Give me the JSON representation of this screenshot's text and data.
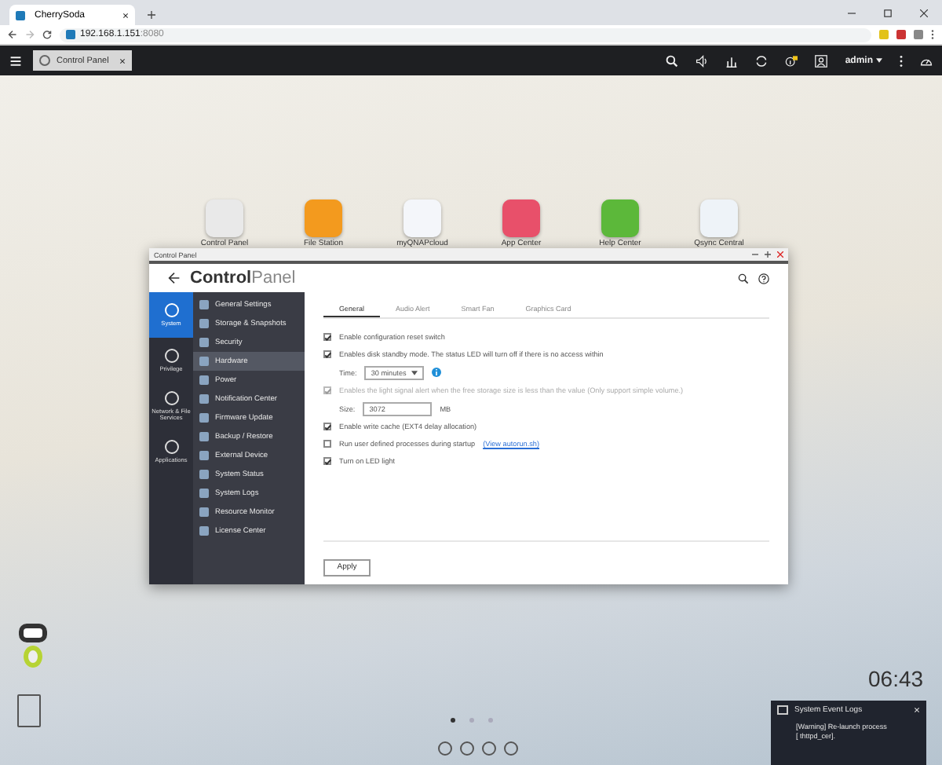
{
  "browser": {
    "tab_title": "CherrySoda",
    "url_host": "192.168.1.151",
    "url_port": ":8080"
  },
  "topbar": {
    "task": "Control Panel",
    "user": "admin"
  },
  "desktop_icons": [
    {
      "label": "Control Panel",
      "kind": "gear"
    },
    {
      "label": "File Station",
      "kind": "folder"
    },
    {
      "label": "myQNAPcloud",
      "kind": "cloud"
    },
    {
      "label": "App Center",
      "kind": "grid"
    },
    {
      "label": "Help Center",
      "kind": "help"
    },
    {
      "label": "Qsync Central",
      "kind": "sync"
    }
  ],
  "window": {
    "title": "Control Panel",
    "heading_bold": "Control",
    "heading_light": "Panel",
    "categories": [
      {
        "label": "System",
        "selected": true
      },
      {
        "label": "Privilege",
        "selected": false
      },
      {
        "label": "Network & File Services",
        "selected": false
      },
      {
        "label": "Applications",
        "selected": false
      }
    ],
    "menu": [
      {
        "label": "General Settings",
        "selected": false
      },
      {
        "label": "Storage & Snapshots",
        "selected": false
      },
      {
        "label": "Security",
        "selected": false
      },
      {
        "label": "Hardware",
        "selected": true
      },
      {
        "label": "Power",
        "selected": false
      },
      {
        "label": "Notification Center",
        "selected": false
      },
      {
        "label": "Firmware Update",
        "selected": false
      },
      {
        "label": "Backup / Restore",
        "selected": false
      },
      {
        "label": "External Device",
        "selected": false
      },
      {
        "label": "System Status",
        "selected": false
      },
      {
        "label": "System Logs",
        "selected": false
      },
      {
        "label": "Resource Monitor",
        "selected": false
      },
      {
        "label": "License Center",
        "selected": false
      }
    ],
    "tabs": [
      {
        "label": "General",
        "selected": true
      },
      {
        "label": "Audio Alert",
        "selected": false
      },
      {
        "label": "Smart Fan",
        "selected": false
      },
      {
        "label": "Graphics Card",
        "selected": false
      }
    ],
    "options": [
      {
        "kind": "checkbox",
        "label": "Enable configuration reset switch",
        "checked": true,
        "disabled": false
      },
      {
        "kind": "checkbox",
        "label": "Enables disk standby mode. The status LED will turn off if there is no access within",
        "checked": true,
        "disabled": false
      },
      {
        "kind": "select",
        "label": "Time:",
        "value": "30 minutes"
      },
      {
        "kind": "checkbox",
        "label": "Enables the light signal alert when the free storage size is less than the value (Only support simple volume.)",
        "checked": true,
        "disabled": true
      },
      {
        "kind": "input",
        "label": "Size:",
        "value": "3072",
        "unit": "MB"
      },
      {
        "kind": "checkbox",
        "label": "Enable write cache (EXT4 delay allocation)",
        "checked": true,
        "disabled": false
      },
      {
        "kind": "checkbox",
        "label": "Run user defined processes during startup",
        "checked": false,
        "disabled": false,
        "link": "(View autorun.sh)"
      },
      {
        "kind": "checkbox",
        "label": "Turn on LED light",
        "checked": true,
        "disabled": false
      }
    ],
    "apply": "Apply"
  },
  "clock": "06:43",
  "notification": {
    "title": "System Event Logs",
    "message": "[Warning] Re-launch process [ thttpd_cer]."
  },
  "pages": [
    {
      "selected": true
    },
    {
      "selected": false
    },
    {
      "selected": false
    }
  ]
}
